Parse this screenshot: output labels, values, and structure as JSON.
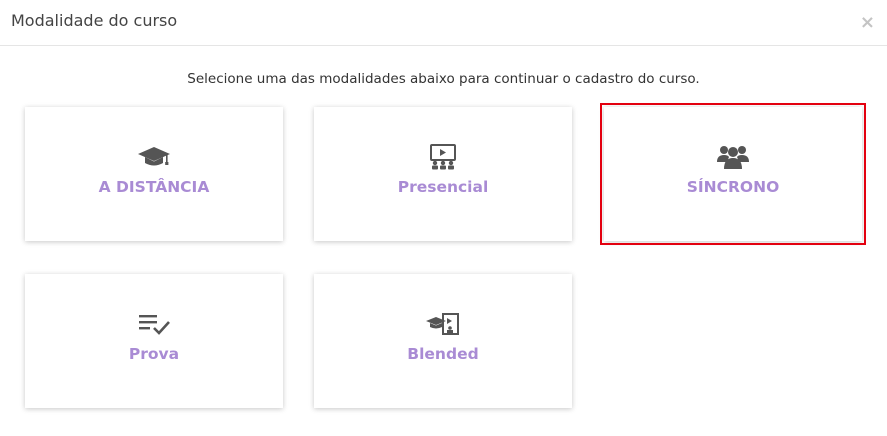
{
  "modal": {
    "title": "Modalidade do curso",
    "close_symbol": "×",
    "instruction": "Selecione uma das modalidades abaixo para continuar o cadastro do curso."
  },
  "options": [
    {
      "label": "A DISTÂNCIA",
      "icon": "graduation-cap-icon",
      "selected": false
    },
    {
      "label": "Presencial",
      "icon": "presentation-icon",
      "selected": false
    },
    {
      "label": "SÍNCRONO",
      "icon": "users-group-icon",
      "selected": true
    },
    {
      "label": "Prova",
      "icon": "list-check-icon",
      "selected": false
    },
    {
      "label": "Blended",
      "icon": "blended-icon",
      "selected": false
    }
  ],
  "colors": {
    "label": "#a98bd4",
    "icon": "#555555",
    "selected_border": "#e3000f"
  }
}
